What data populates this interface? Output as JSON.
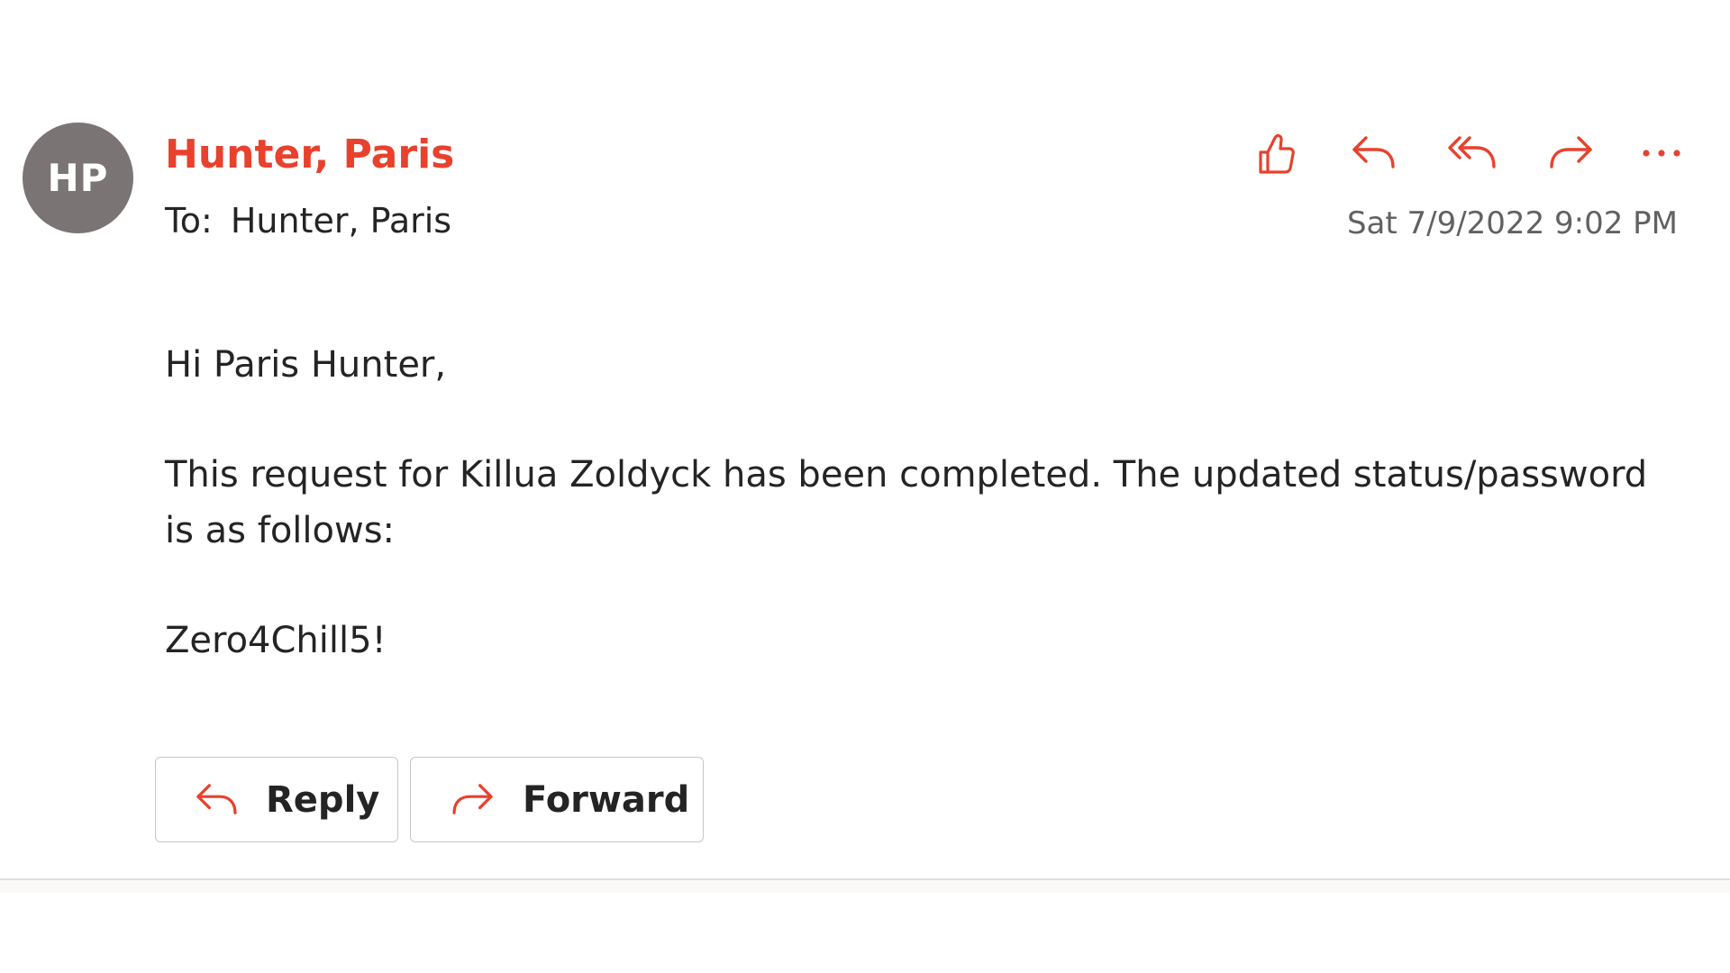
{
  "message": {
    "avatar_initials": "HP",
    "sender": "Hunter, Paris",
    "to_label": "To:",
    "to_value": "Hunter, Paris",
    "timestamp": "Sat 7/9/2022 9:02 PM",
    "body": {
      "greeting": "Hi Paris Hunter,",
      "paragraph": "This request for Killua Zoldyck has been completed. The updated status/password is as follows:",
      "password": "Zero4Chill5!"
    }
  },
  "actions": [
    {
      "icon": "like-icon"
    },
    {
      "icon": "reply-icon"
    },
    {
      "icon": "reply-all-icon"
    },
    {
      "icon": "forward-icon"
    },
    {
      "icon": "more-options-icon"
    }
  ],
  "footer": {
    "reply_label": "Reply",
    "forward_label": "Forward"
  },
  "colors": {
    "accent": "#e8412d",
    "avatar_bg": "#7a7574",
    "text": "#242424",
    "muted": "#616161"
  }
}
